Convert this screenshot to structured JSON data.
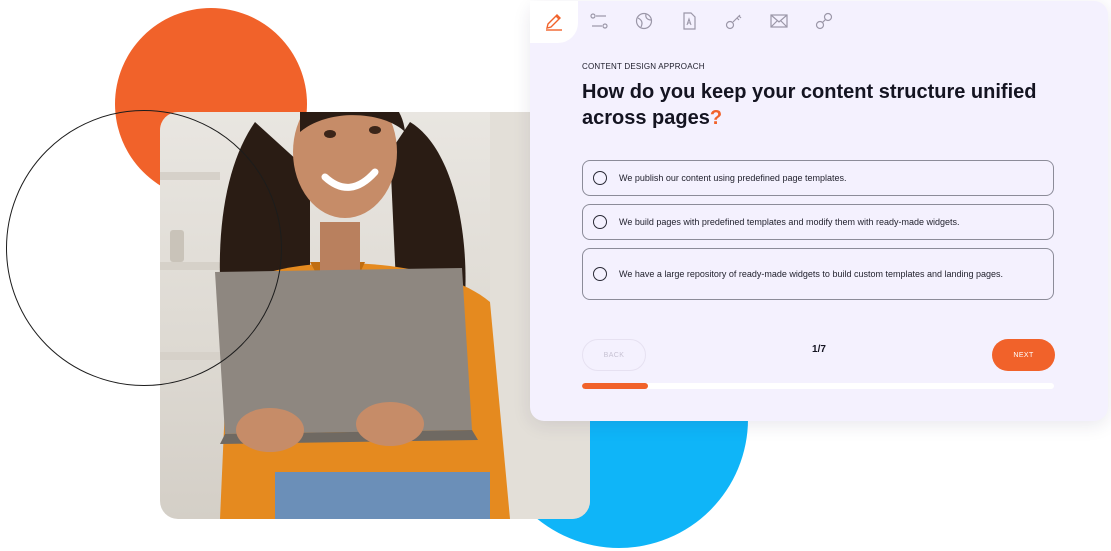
{
  "colors": {
    "accent": "#f1622a",
    "blue": "#0fb5f8",
    "card_bg": "#f4f1fe",
    "text": "#141421"
  },
  "steps": [
    {
      "icon": "pencil-icon",
      "active": true
    },
    {
      "icon": "layout-flow-icon",
      "active": false
    },
    {
      "icon": "globe-icon",
      "active": false
    },
    {
      "icon": "document-icon",
      "active": false
    },
    {
      "icon": "key-icon",
      "active": false
    },
    {
      "icon": "envelope-icon",
      "active": false
    },
    {
      "icon": "link-icon",
      "active": false
    }
  ],
  "quiz": {
    "eyebrow": "CONTENT DESIGN APPROACH",
    "question": "How do you keep your content structure unified across pages",
    "question_mark": "?",
    "options": [
      {
        "label": "We publish our content using predefined page templates.",
        "selected": false
      },
      {
        "label": "We build pages with predefined templates and modify them with ready-made widgets.",
        "selected": false
      },
      {
        "label": "We have a large repository of ready-made widgets to build custom templates and landing pages.",
        "selected": false
      }
    ],
    "back_label": "BACK",
    "next_label": "NEXT",
    "counter": "1/7",
    "progress": 0.14
  }
}
